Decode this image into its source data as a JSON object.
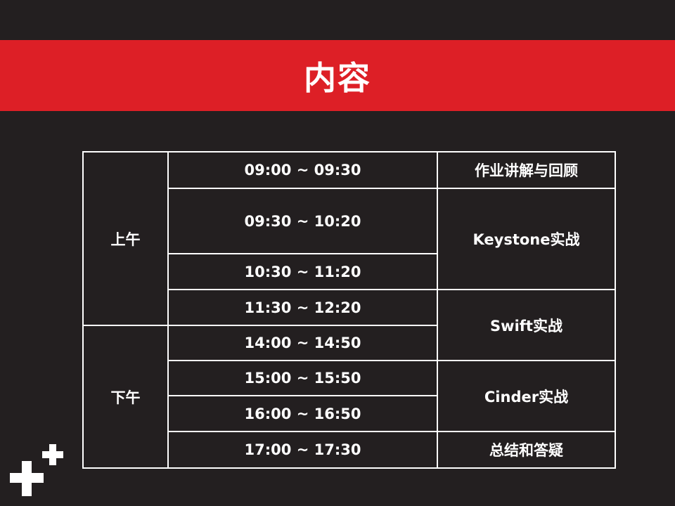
{
  "header": {
    "title": "内容"
  },
  "schedule": {
    "periods": {
      "morning": "上午",
      "afternoon": "下午"
    },
    "times": [
      "09:00 ~ 09:30",
      "09:30 ~ 10:20",
      "10:30 ~ 11:20",
      "11:30 ~ 12:20",
      "14:00 ~ 14:50",
      "15:00 ~ 15:50",
      "16:00 ~ 16:50",
      "17:00 ~ 17:30"
    ],
    "topics": [
      "作业讲解与回顾",
      "Keystone实战",
      "Swift实战",
      "Cinder实战",
      "总结和答疑"
    ]
  },
  "colors": {
    "background": "#231f20",
    "header_bar": "#dd1f26",
    "text": "#ffffff",
    "border": "#ffffff"
  },
  "icons": {
    "logo": "plus-plus-logo-icon"
  }
}
